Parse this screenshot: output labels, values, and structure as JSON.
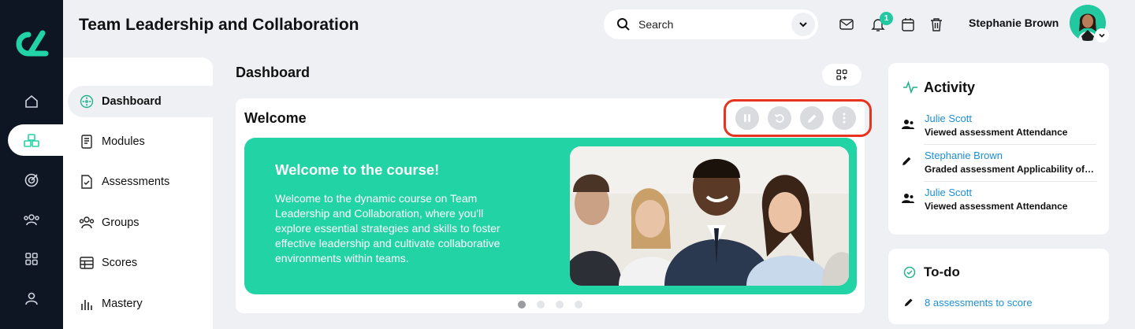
{
  "header": {
    "title": "Team Leadership and Collaboration",
    "search_placeholder": "Search",
    "notification_count": "1",
    "user_name": "Stephanie Brown"
  },
  "rail": {
    "items": [
      "home-icon",
      "modules-cubes-icon",
      "target-icon",
      "users-icon",
      "grid-icon",
      "profile-icon"
    ]
  },
  "sidebar": {
    "items": [
      {
        "label": "Dashboard",
        "icon": "compass-icon"
      },
      {
        "label": "Modules",
        "icon": "book-icon"
      },
      {
        "label": "Assessments",
        "icon": "document-icon"
      },
      {
        "label": "Groups",
        "icon": "users-icon"
      },
      {
        "label": "Scores",
        "icon": "table-icon"
      },
      {
        "label": "Mastery",
        "icon": "bar-chart-icon"
      }
    ]
  },
  "main": {
    "title": "Dashboard",
    "welcome": {
      "title": "Welcome",
      "banner_heading": "Welcome to the course!",
      "banner_text": "Welcome to the dynamic course on Team Leadership and Collaboration, where you'll explore essential strategies and skills to foster effective leadership and cultivate collaborative environments within teams.",
      "slides": 4,
      "active_slide": 1
    }
  },
  "activity": {
    "title": "Activity",
    "items": [
      {
        "name": "Julie Scott",
        "text": "Viewed assessment Attendance",
        "icon": "user-view-icon"
      },
      {
        "name": "Stephanie Brown",
        "text": "Graded assessment Applicability of Laws",
        "icon": "pencil-icon"
      },
      {
        "name": "Julie Scott",
        "text": "Viewed assessment Attendance",
        "icon": "user-view-icon"
      }
    ]
  },
  "todo": {
    "title": "To-do",
    "link": "8 assessments to score"
  },
  "colors": {
    "accent": "#22d3a5",
    "rail": "#0f1623",
    "link": "#1c8fd6",
    "highlight": "#e8331f"
  }
}
